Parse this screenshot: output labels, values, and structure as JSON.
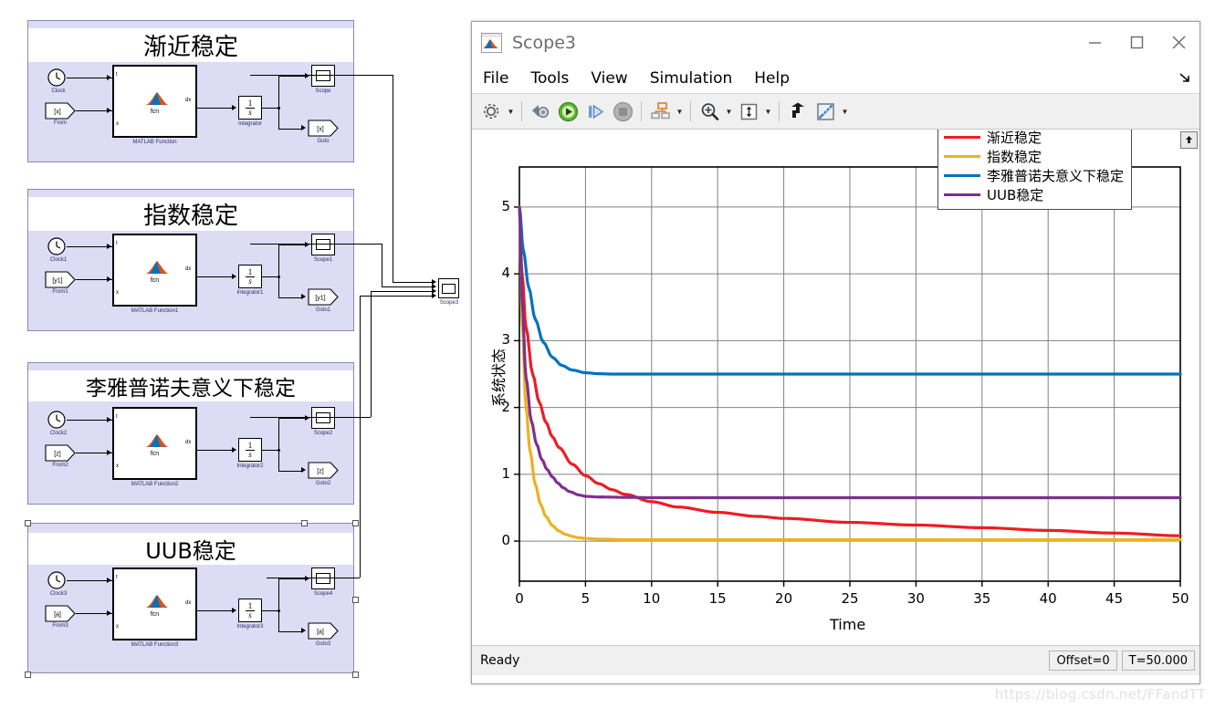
{
  "watermark": "https://blog.csdn.net/FFandTT",
  "simulink": {
    "groups": [
      {
        "title": "渐近稳定",
        "clock": "Clock",
        "from": "From",
        "from_tag": "[x]",
        "mfun": "MATLAB Function",
        "mfun_body": "fcn",
        "port_t": "t",
        "port_x": "x",
        "port_dx": "dx",
        "integrator": "Integrator",
        "integrator_body": "1/s",
        "scope": "Scope",
        "goto": "Goto",
        "goto_tag": "[x]"
      },
      {
        "title": "指数稳定",
        "clock": "Clock1",
        "from": "From1",
        "from_tag": "[y1]",
        "mfun": "MATLAB Function1",
        "mfun_body": "fcn",
        "port_t": "t",
        "port_x": "x",
        "port_dx": "dx",
        "integrator": "Integrator1",
        "integrator_body": "1/s",
        "scope": "Scope1",
        "goto": "Goto1",
        "goto_tag": "[y1]"
      },
      {
        "title": "李雅普诺夫意义下稳定",
        "clock": "Clock2",
        "from": "From2",
        "from_tag": "[z]",
        "mfun": "MATLAB Function2",
        "mfun_body": "fcn",
        "port_t": "t",
        "port_x": "x",
        "port_dx": "dx",
        "integrator": "Integrator2",
        "integrator_body": "1/s",
        "scope": "Scope2",
        "goto": "Goto2",
        "goto_tag": "[z]"
      },
      {
        "title": "UUB稳定",
        "clock": "Clock3",
        "from": "From3",
        "from_tag": "[a]",
        "mfun": "MATLAB Function3",
        "mfun_body": "fcn",
        "port_t": "t",
        "port_x": "x",
        "port_dx": "dx",
        "integrator": "Integrator3",
        "integrator_body": "1/s",
        "scope": "Scope4",
        "goto": "Goto3",
        "goto_tag": "[a]"
      }
    ],
    "scope3_label": "Scope3"
  },
  "scope": {
    "title": "Scope3",
    "window_buttons": {
      "minimize": "—",
      "maximize": "□",
      "close": "✕"
    },
    "menus": [
      "File",
      "Tools",
      "View",
      "Simulation",
      "Help"
    ],
    "menu_overflow_icon": "overflow-arrow-icon",
    "toolbar": [
      {
        "name": "configuration-properties-icon",
        "caret": true
      },
      {
        "name": "print-icon",
        "caret": false
      },
      {
        "name": "run-icon",
        "caret": false
      },
      {
        "name": "step-forward-icon",
        "caret": false
      },
      {
        "name": "stop-icon",
        "caret": false
      },
      {
        "name": "signal-selection-icon",
        "caret": true
      },
      {
        "name": "zoom-in-icon",
        "caret": true
      },
      {
        "name": "autoscale-icon",
        "caret": true
      },
      {
        "name": "trigger-icon",
        "caret": false
      },
      {
        "name": "cursor-measurements-icon",
        "caret": true
      }
    ],
    "statusbar": {
      "state": "Ready",
      "offset": "Offset=0",
      "time": "T=50.000"
    },
    "scroll_button_icon": "scroll-to-top-icon"
  },
  "chart_data": {
    "type": "line",
    "title": "",
    "xlabel": "Time",
    "ylabel": "系统状态",
    "xlim": [
      0,
      50
    ],
    "ylim": [
      -0.6,
      5.6
    ],
    "xticks": [
      0,
      5,
      10,
      15,
      20,
      25,
      30,
      35,
      40,
      45,
      50
    ],
    "yticks": [
      0,
      1,
      2,
      3,
      4,
      5
    ],
    "grid": true,
    "legend_position": "top-right",
    "colors": {
      "asymptotic": "#ED1C24",
      "exponential": "#EDB120",
      "lyapunov": "#0072BD",
      "uub": "#7E2F8E"
    },
    "series": [
      {
        "name": "渐近稳定",
        "color": "#ED1C24",
        "x": [
          0,
          0.2,
          0.5,
          1,
          1.5,
          2,
          2.5,
          3,
          4,
          5,
          6,
          7,
          8,
          10,
          12,
          15,
          18,
          20,
          25,
          30,
          35,
          40,
          45,
          50
        ],
        "values": [
          5,
          4.0,
          3.2,
          2.5,
          2.08,
          1.78,
          1.56,
          1.4,
          1.15,
          0.98,
          0.86,
          0.77,
          0.7,
          0.59,
          0.51,
          0.43,
          0.37,
          0.34,
          0.28,
          0.24,
          0.2,
          0.16,
          0.12,
          0.08
        ]
      },
      {
        "name": "指数稳定",
        "color": "#EDB120",
        "x": [
          0,
          0.2,
          0.5,
          0.8,
          1.2,
          1.6,
          2,
          2.5,
          3,
          3.5,
          4,
          4.5,
          5,
          6,
          8,
          10,
          20,
          30,
          40,
          50
        ],
        "values": [
          5,
          3.3,
          2.0,
          1.35,
          0.85,
          0.55,
          0.37,
          0.23,
          0.15,
          0.1,
          0.07,
          0.05,
          0.04,
          0.03,
          0.02,
          0.02,
          0.02,
          0.02,
          0.02,
          0.02
        ]
      },
      {
        "name": "李雅普诺夫意义下稳定",
        "color": "#0072BD",
        "x": [
          0,
          0.3,
          0.7,
          1.2,
          1.8,
          2.5,
          3.2,
          4,
          5,
          6,
          7,
          8,
          10,
          15,
          20,
          30,
          40,
          50
        ],
        "values": [
          5,
          4.35,
          3.8,
          3.32,
          2.98,
          2.75,
          2.63,
          2.56,
          2.52,
          2.505,
          2.5,
          2.5,
          2.5,
          2.5,
          2.5,
          2.5,
          2.5,
          2.5
        ]
      },
      {
        "name": "UUB稳定",
        "color": "#7E2F8E",
        "x": [
          0,
          0.2,
          0.5,
          0.9,
          1.3,
          1.7,
          2.1,
          2.5,
          2.9,
          3.3,
          3.8,
          4.5,
          5,
          6,
          8,
          10,
          20,
          30,
          40,
          50
        ],
        "values": [
          5,
          3.6,
          2.45,
          1.8,
          1.45,
          1.22,
          1.07,
          0.96,
          0.87,
          0.8,
          0.74,
          0.69,
          0.67,
          0.66,
          0.655,
          0.65,
          0.65,
          0.65,
          0.65,
          0.65
        ]
      }
    ]
  }
}
